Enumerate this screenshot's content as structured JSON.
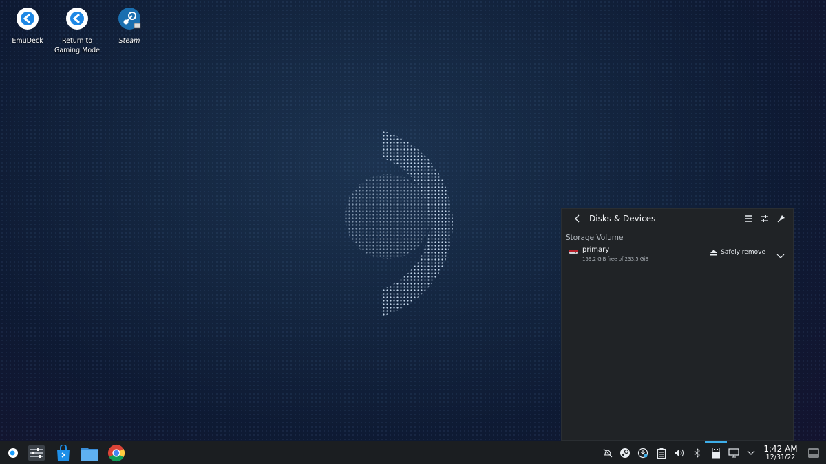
{
  "desktop": {
    "icons": [
      {
        "label": "EmuDeck"
      },
      {
        "label": "Return to\nGaming Mode"
      },
      {
        "label": "Steam"
      }
    ]
  },
  "popup": {
    "title": "Disks & Devices",
    "section": "Storage Volume",
    "device": {
      "name": "primary",
      "details": "159.2 GiB free of 233.5 GiB",
      "action": "Safely remove"
    }
  },
  "taskbar": {
    "clock_time": "1:42 AM",
    "clock_date": "12/31/22"
  },
  "colors": {
    "accent": "#3daee9",
    "panel_bg": "#202326",
    "taskbar_bg": "#1b1e21"
  }
}
